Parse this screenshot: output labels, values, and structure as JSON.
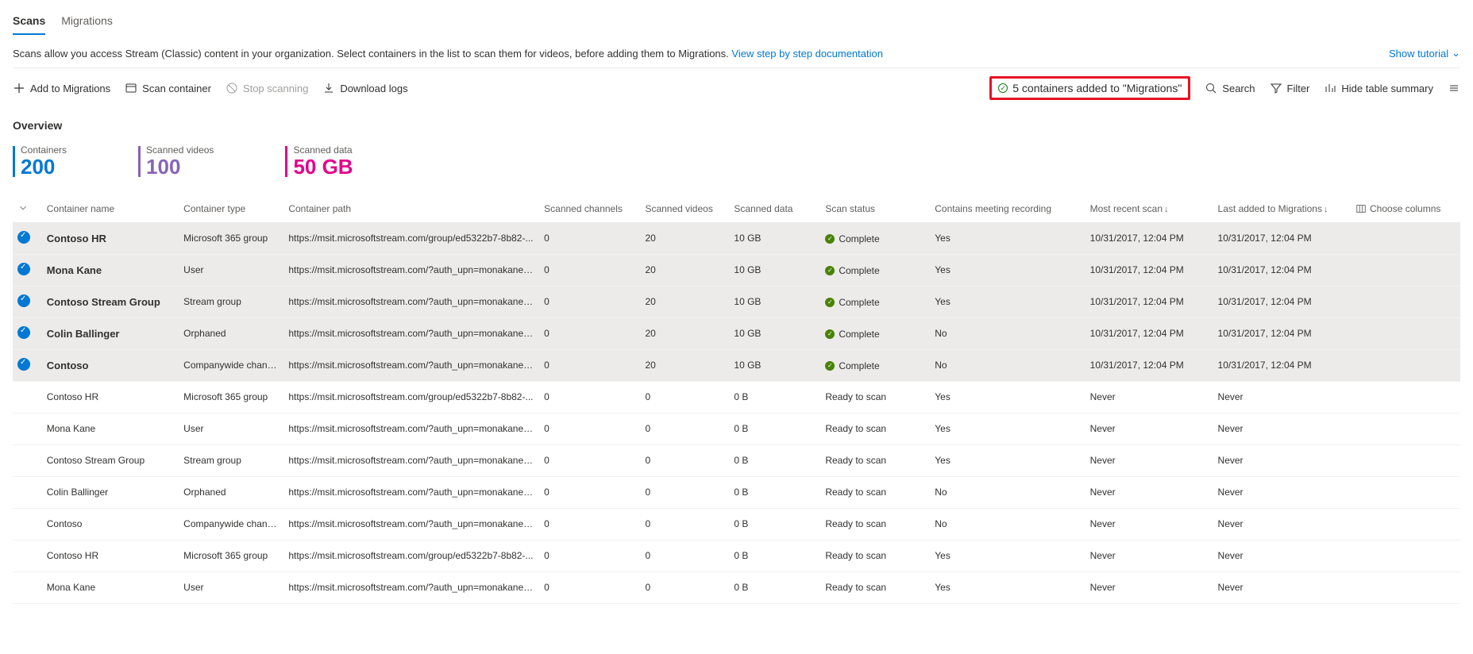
{
  "tabs": {
    "scans": "Scans",
    "migrations": "Migrations"
  },
  "description": "Scans allow you access Stream (Classic) content in your organization. Select containers in the list to scan them for videos, before adding them to Migrations.",
  "doc_link": "View step by step documentation",
  "show_tutorial": "Show tutorial",
  "commands": {
    "add": "Add to Migrations",
    "scan": "Scan container",
    "stop": "Stop scanning",
    "download": "Download logs",
    "search": "Search",
    "filter": "Filter",
    "hide_summary": "Hide table summary"
  },
  "notification": "5 containers added to \"Migrations\"",
  "overview_title": "Overview",
  "stats": {
    "containers_label": "Containers",
    "containers_value": "200",
    "videos_label": "Scanned videos",
    "videos_value": "100",
    "data_label": "Scanned data",
    "data_value": "50 GB"
  },
  "columns": {
    "name": "Container name",
    "type": "Container type",
    "path": "Container path",
    "channels": "Scanned channels",
    "videos": "Scanned videos",
    "data": "Scanned data",
    "status": "Scan status",
    "recording": "Contains meeting recording",
    "recent": "Most recent scan",
    "last_added": "Last added to Migrations",
    "choose": "Choose columns"
  },
  "rows": [
    {
      "sel": true,
      "name": "Contoso HR",
      "type": "Microsoft 365 group",
      "path": "https://msit.microsoftstream.com/group/ed5322b7-8b82-...",
      "channels": "0",
      "videos": "20",
      "data": "10 GB",
      "status": "Complete",
      "status_ok": true,
      "rec": "Yes",
      "recent": "10/31/2017, 12:04 PM",
      "added": "10/31/2017, 12:04 PM"
    },
    {
      "sel": true,
      "name": "Mona Kane",
      "type": "User",
      "path": "https://msit.microsoftstream.com/?auth_upn=monakane@...",
      "channels": "0",
      "videos": "20",
      "data": "10 GB",
      "status": "Complete",
      "status_ok": true,
      "rec": "Yes",
      "recent": "10/31/2017, 12:04 PM",
      "added": "10/31/2017, 12:04 PM"
    },
    {
      "sel": true,
      "name": "Contoso Stream Group",
      "type": "Stream group",
      "path": "https://msit.microsoftstream.com/?auth_upn=monakane@...",
      "channels": "0",
      "videos": "20",
      "data": "10 GB",
      "status": "Complete",
      "status_ok": true,
      "rec": "Yes",
      "recent": "10/31/2017, 12:04 PM",
      "added": "10/31/2017, 12:04 PM"
    },
    {
      "sel": true,
      "name": "Colin Ballinger",
      "type": "Orphaned",
      "path": "https://msit.microsoftstream.com/?auth_upn=monakane@...",
      "channels": "0",
      "videos": "20",
      "data": "10 GB",
      "status": "Complete",
      "status_ok": true,
      "rec": "No",
      "recent": "10/31/2017, 12:04 PM",
      "added": "10/31/2017, 12:04 PM"
    },
    {
      "sel": true,
      "name": "Contoso",
      "type": "Companywide channel",
      "path": "https://msit.microsoftstream.com/?auth_upn=monakane@...",
      "channels": "0",
      "videos": "20",
      "data": "10 GB",
      "status": "Complete",
      "status_ok": true,
      "rec": "No",
      "recent": "10/31/2017, 12:04 PM",
      "added": "10/31/2017, 12:04 PM"
    },
    {
      "sel": false,
      "name": "Contoso HR",
      "type": "Microsoft 365 group",
      "path": "https://msit.microsoftstream.com/group/ed5322b7-8b82-...",
      "channels": "0",
      "videos": "0",
      "data": "0 B",
      "status": "Ready to scan",
      "status_ok": false,
      "rec": "Yes",
      "recent": "Never",
      "added": "Never"
    },
    {
      "sel": false,
      "name": "Mona Kane",
      "type": "User",
      "path": "https://msit.microsoftstream.com/?auth_upn=monakane@...",
      "channels": "0",
      "videos": "0",
      "data": "0 B",
      "status": "Ready to scan",
      "status_ok": false,
      "rec": "Yes",
      "recent": "Never",
      "added": "Never"
    },
    {
      "sel": false,
      "name": "Contoso Stream Group",
      "type": "Stream group",
      "path": "https://msit.microsoftstream.com/?auth_upn=monakane@...",
      "channels": "0",
      "videos": "0",
      "data": "0 B",
      "status": "Ready to scan",
      "status_ok": false,
      "rec": "Yes",
      "recent": "Never",
      "added": "Never"
    },
    {
      "sel": false,
      "name": "Colin Ballinger",
      "type": "Orphaned",
      "path": "https://msit.microsoftstream.com/?auth_upn=monakane@...",
      "channels": "0",
      "videos": "0",
      "data": "0 B",
      "status": "Ready to scan",
      "status_ok": false,
      "rec": "No",
      "recent": "Never",
      "added": "Never"
    },
    {
      "sel": false,
      "name": "Contoso",
      "type": "Companywide channel",
      "path": "https://msit.microsoftstream.com/?auth_upn=monakane@...",
      "channels": "0",
      "videos": "0",
      "data": "0 B",
      "status": "Ready to scan",
      "status_ok": false,
      "rec": "No",
      "recent": "Never",
      "added": "Never"
    },
    {
      "sel": false,
      "name": "Contoso HR",
      "type": "Microsoft 365 group",
      "path": "https://msit.microsoftstream.com/group/ed5322b7-8b82-...",
      "channels": "0",
      "videos": "0",
      "data": "0 B",
      "status": "Ready to scan",
      "status_ok": false,
      "rec": "Yes",
      "recent": "Never",
      "added": "Never"
    },
    {
      "sel": false,
      "name": "Mona Kane",
      "type": "User",
      "path": "https://msit.microsoftstream.com/?auth_upn=monakane@...",
      "channels": "0",
      "videos": "0",
      "data": "0 B",
      "status": "Ready to scan",
      "status_ok": false,
      "rec": "Yes",
      "recent": "Never",
      "added": "Never"
    }
  ]
}
